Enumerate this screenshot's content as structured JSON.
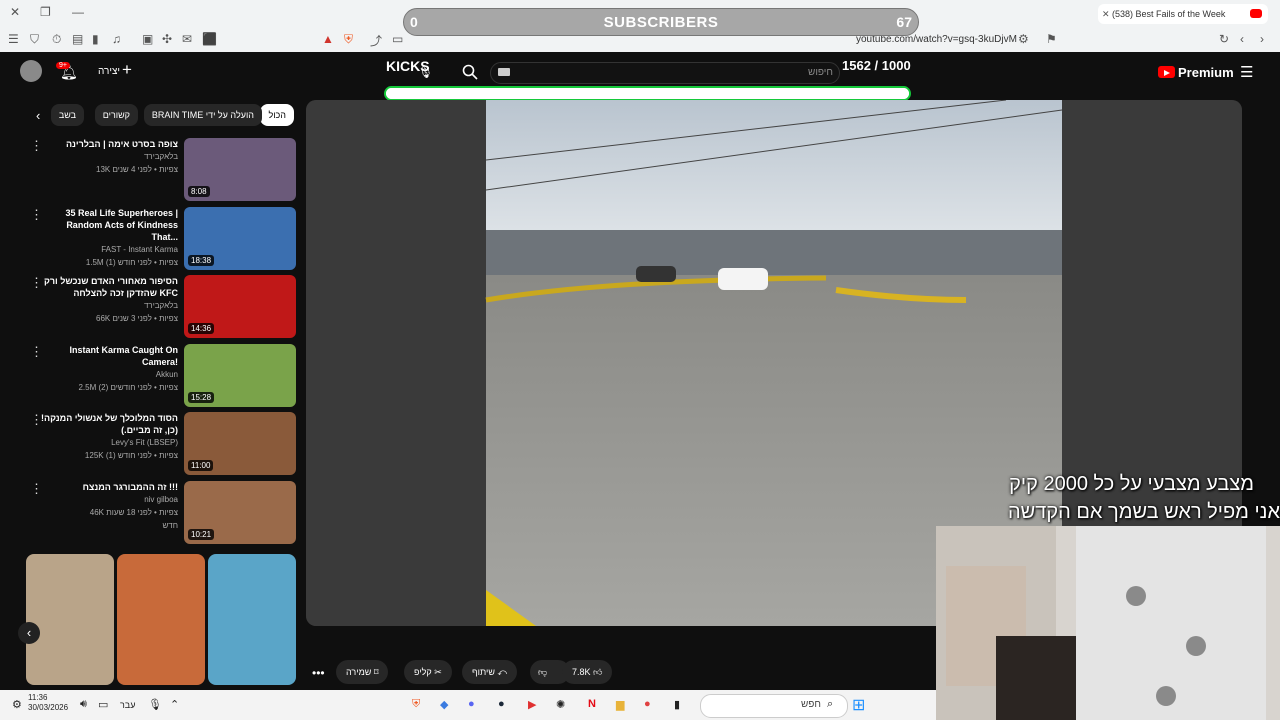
{
  "browser": {
    "tab_title": "(538) Best Fails of the Week",
    "url": "youtube.com/watch?v=gsq-3kuDjvM"
  },
  "overlay": {
    "subs_left": "0",
    "subs_label": "SUBSCRIBERS",
    "subs_right": "67",
    "kicks_label": "KICKS",
    "kicks_count": "1562 / 1000",
    "kicks_progress": 1.0,
    "line1": "מצבע מצבעי על כל 2000 קיק",
    "line2": "אני  מפיל ראש בשמך  אם הקדשה"
  },
  "header": {
    "create_label": "יצירה",
    "notif_badge": "9+",
    "search_placeholder": "חיפוש",
    "premium_label": "Premium"
  },
  "chips": [
    "הכול",
    "BRAIN TIME הועלה על ידי",
    "קשורים",
    "בשב"
  ],
  "related": [
    {
      "title": "צופה בסרט אימה | הבלרינה",
      "channel": "בלאקבירד",
      "views": "13K צפיות • לפני 4 שנים",
      "duration": "8:08",
      "color": "#6b5a7a"
    },
    {
      "title": "35 Real Life Superheroes | Random Acts of Kindness That...",
      "channel": "FAST - Instant Karma",
      "views": "1.5M צפיות • לפני חודש (1)",
      "duration": "18:38",
      "color": "#3b6fb0"
    },
    {
      "title": "הסיפור מאחורי האדם שנכשל ורק שהזדקן זכה להצלחה KFC",
      "channel": "בלאקבירד",
      "views": "66K צפיות • לפני 3 שנים",
      "duration": "14:36",
      "color": "#c01818"
    },
    {
      "title": "Instant Karma Caught On Camera!",
      "channel": "Akkun",
      "views": "2.5M צפיות • לפני חודשים (2)",
      "duration": "15:28",
      "color": "#7aa34a"
    },
    {
      "title": "הסוד המלוכלך של אנשולי המנקה! (כן, זה מביים.)",
      "channel": "Levy's Fit (LBSEP)",
      "views": "125K צפיות • לפני חודש (1)",
      "duration": "11:00",
      "color": "#8a5a3a"
    },
    {
      "title": "זה ההמבורגר המנצח !!!",
      "channel": "niv gilboa",
      "views": "46K צפיות • לפני 18 שעות",
      "duration": "10:21",
      "color": "#9a6a4a",
      "badge": "חדש"
    }
  ],
  "shorts_colors": [
    "#b9a489",
    "#c86a3a",
    "#5aa5c8"
  ],
  "actions": {
    "likes": "7.8K",
    "share": "שיתוף",
    "clip": "קליפ",
    "save": "שמירה"
  },
  "taskbar": {
    "time": "11:36",
    "date": "30/03/2026",
    "lang": "עבר",
    "search": "חפש"
  }
}
